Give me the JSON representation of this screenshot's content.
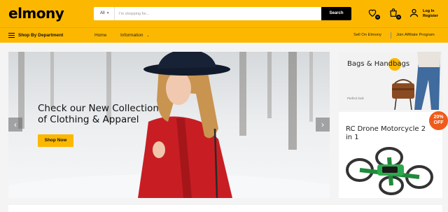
{
  "brand": {
    "logo": "elmony",
    "accent": "#fcb800",
    "dark": "#000000"
  },
  "search": {
    "category": "All",
    "placeholder": "I'm shopping for...",
    "button": "Search"
  },
  "header_icons": [
    {
      "icon": "heart-icon",
      "badge": "0"
    },
    {
      "icon": "shopping-bag-icon",
      "badge": "0"
    }
  ],
  "account": {
    "icon": "user-icon",
    "login": "Log In",
    "register": "Register"
  },
  "nav": {
    "department": "Shop By Department",
    "items": [
      "Home",
      "Information"
    ],
    "right": [
      "Sell On Elmony",
      "Join Affiliate Program"
    ]
  },
  "hero": {
    "line1": "Check our New Collection",
    "line2": "of Clothing & Apparel",
    "cta": "Shop Now",
    "prev": "‹",
    "next": "›"
  },
  "promos": [
    {
      "title": "Bags & Handbags",
      "subtitle": "Perfect look"
    },
    {
      "title": "RC Drone Motorcycle 2 in 1",
      "discount_line1": "20%",
      "discount_line2": "OFF"
    }
  ]
}
